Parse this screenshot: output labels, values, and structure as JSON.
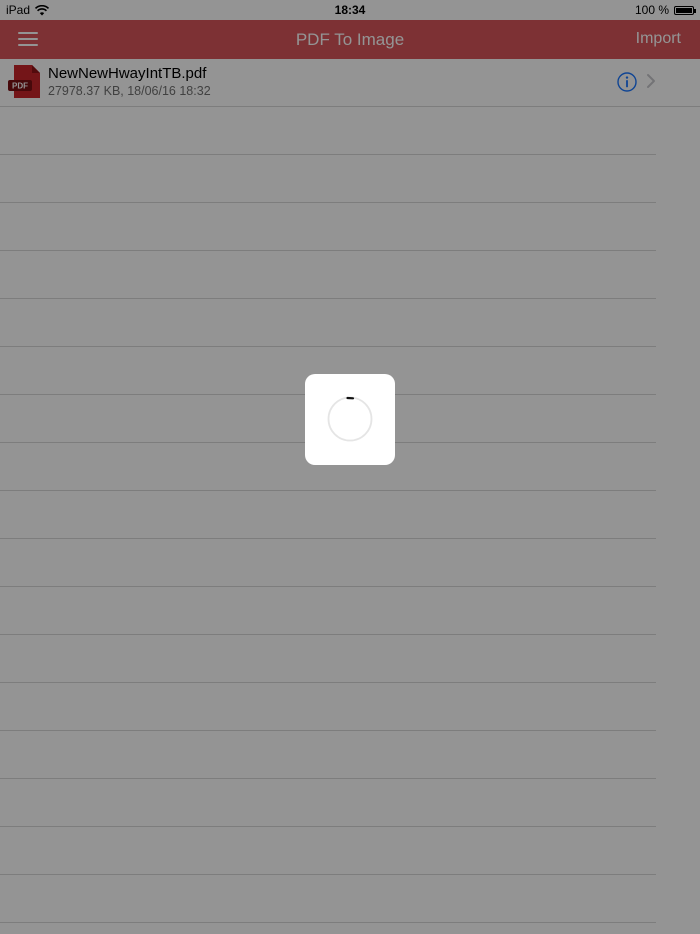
{
  "status_bar": {
    "device": "iPad",
    "wifi_icon": "wifi-icon",
    "time": "18:34",
    "battery": "100 %",
    "battery_icon": "battery-icon"
  },
  "nav_bar": {
    "menu_icon": "hamburger-menu-icon",
    "title": "PDF To Image",
    "import_label": "Import",
    "color": "#d7555a"
  },
  "files": [
    {
      "icon": "pdf-file-icon",
      "icon_label": "PDF",
      "name": "NewNewHwayIntTB.pdf",
      "meta": "27978.37 KB, 18/06/16 18:32",
      "info_icon": "info-icon",
      "chevron_icon": "chevron-right-icon"
    }
  ],
  "loading": {
    "spinner_icon": "spinner-icon"
  }
}
